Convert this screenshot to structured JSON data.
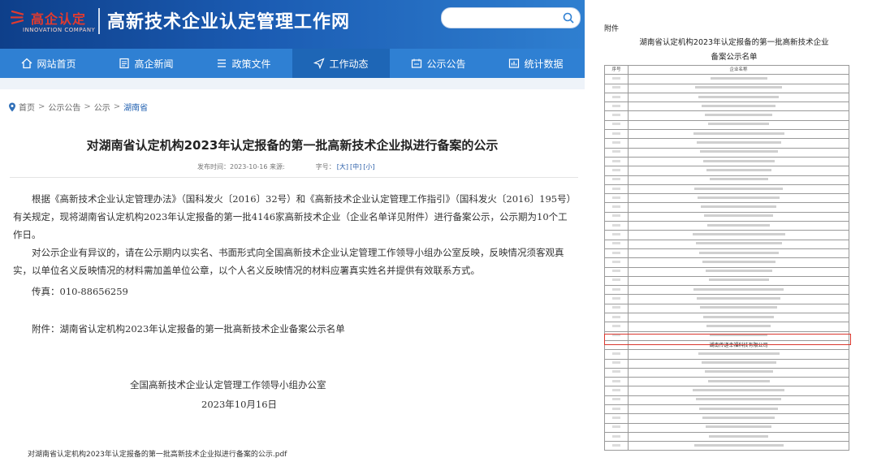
{
  "site": {
    "logo_text": "高企认定",
    "logo_subtext": "INNOVATION COMPANY",
    "name": "高新技术企业认定管理工作网",
    "search_placeholder": ""
  },
  "nav": [
    {
      "label": "网站首页",
      "icon": "home-icon"
    },
    {
      "label": "高企新闻",
      "icon": "news-icon"
    },
    {
      "label": "政策文件",
      "icon": "document-icon"
    },
    {
      "label": "工作动态",
      "icon": "send-icon",
      "active": true
    },
    {
      "label": "公示公告",
      "icon": "notice-icon"
    },
    {
      "label": "统计数据",
      "icon": "chart-icon"
    }
  ],
  "breadcrumb": [
    "首页",
    "公示公告",
    "公示",
    "湖南省"
  ],
  "article": {
    "title": "对湖南省认定机构2023年认定报备的第一批高新技术企业拟进行备案的公示",
    "meta_date": "发布时间：2023-10-16 来源:",
    "meta_fontsize_label": "字号：",
    "size_large": "[大]",
    "size_medium": "[中]",
    "size_small": "[小]",
    "para1": "根据《高新技术企业认定管理办法》（国科发火〔2016〕32号）和《高新技术企业认定管理工作指引》（国科发火〔2016〕195号）有关规定，现将湖南省认定机构2023年认定报备的第一批4146家高新技术企业（企业名单详见附件）进行备案公示，公示期为10个工作日。",
    "para2": "对公示企业有异议的，请在公示期内以实名、书面形式向全国高新技术企业认定管理工作领导小组办公室反映，反映情况须客观真实，以单位名义反映情况的材料需加盖单位公章，以个人名义反映情况的材料应署真实姓名并提供有效联系方式。",
    "fax": "传真：010-88656259",
    "attachment": "附件：湖南省认定机构2023年认定报备的第一批高新技术企业备案公示名单",
    "signature": "全国高新技术企业认定管理工作领导小组办公室",
    "sign_date": "2023年10月16日",
    "pdf_link": "对湖南省认定机构2023年认定报备的第一批高新技术企业拟进行备案的公示.pdf"
  },
  "attachment_doc": {
    "label": "附件",
    "title_line1": "湖南省认定机构2023年认定报备的第一批高新技术企业",
    "title_line2": "备案公示名单",
    "col_no": "序号",
    "col_name": "企业名称",
    "highlighted_company": "湖南传递幸福科技有限公司"
  },
  "colors": {
    "banner": "#1b5cb3",
    "nav": "#2f80d3",
    "nav_active": "#1e66b6",
    "logo_red": "#e23a2e",
    "highlight_border": "#d9382f"
  }
}
